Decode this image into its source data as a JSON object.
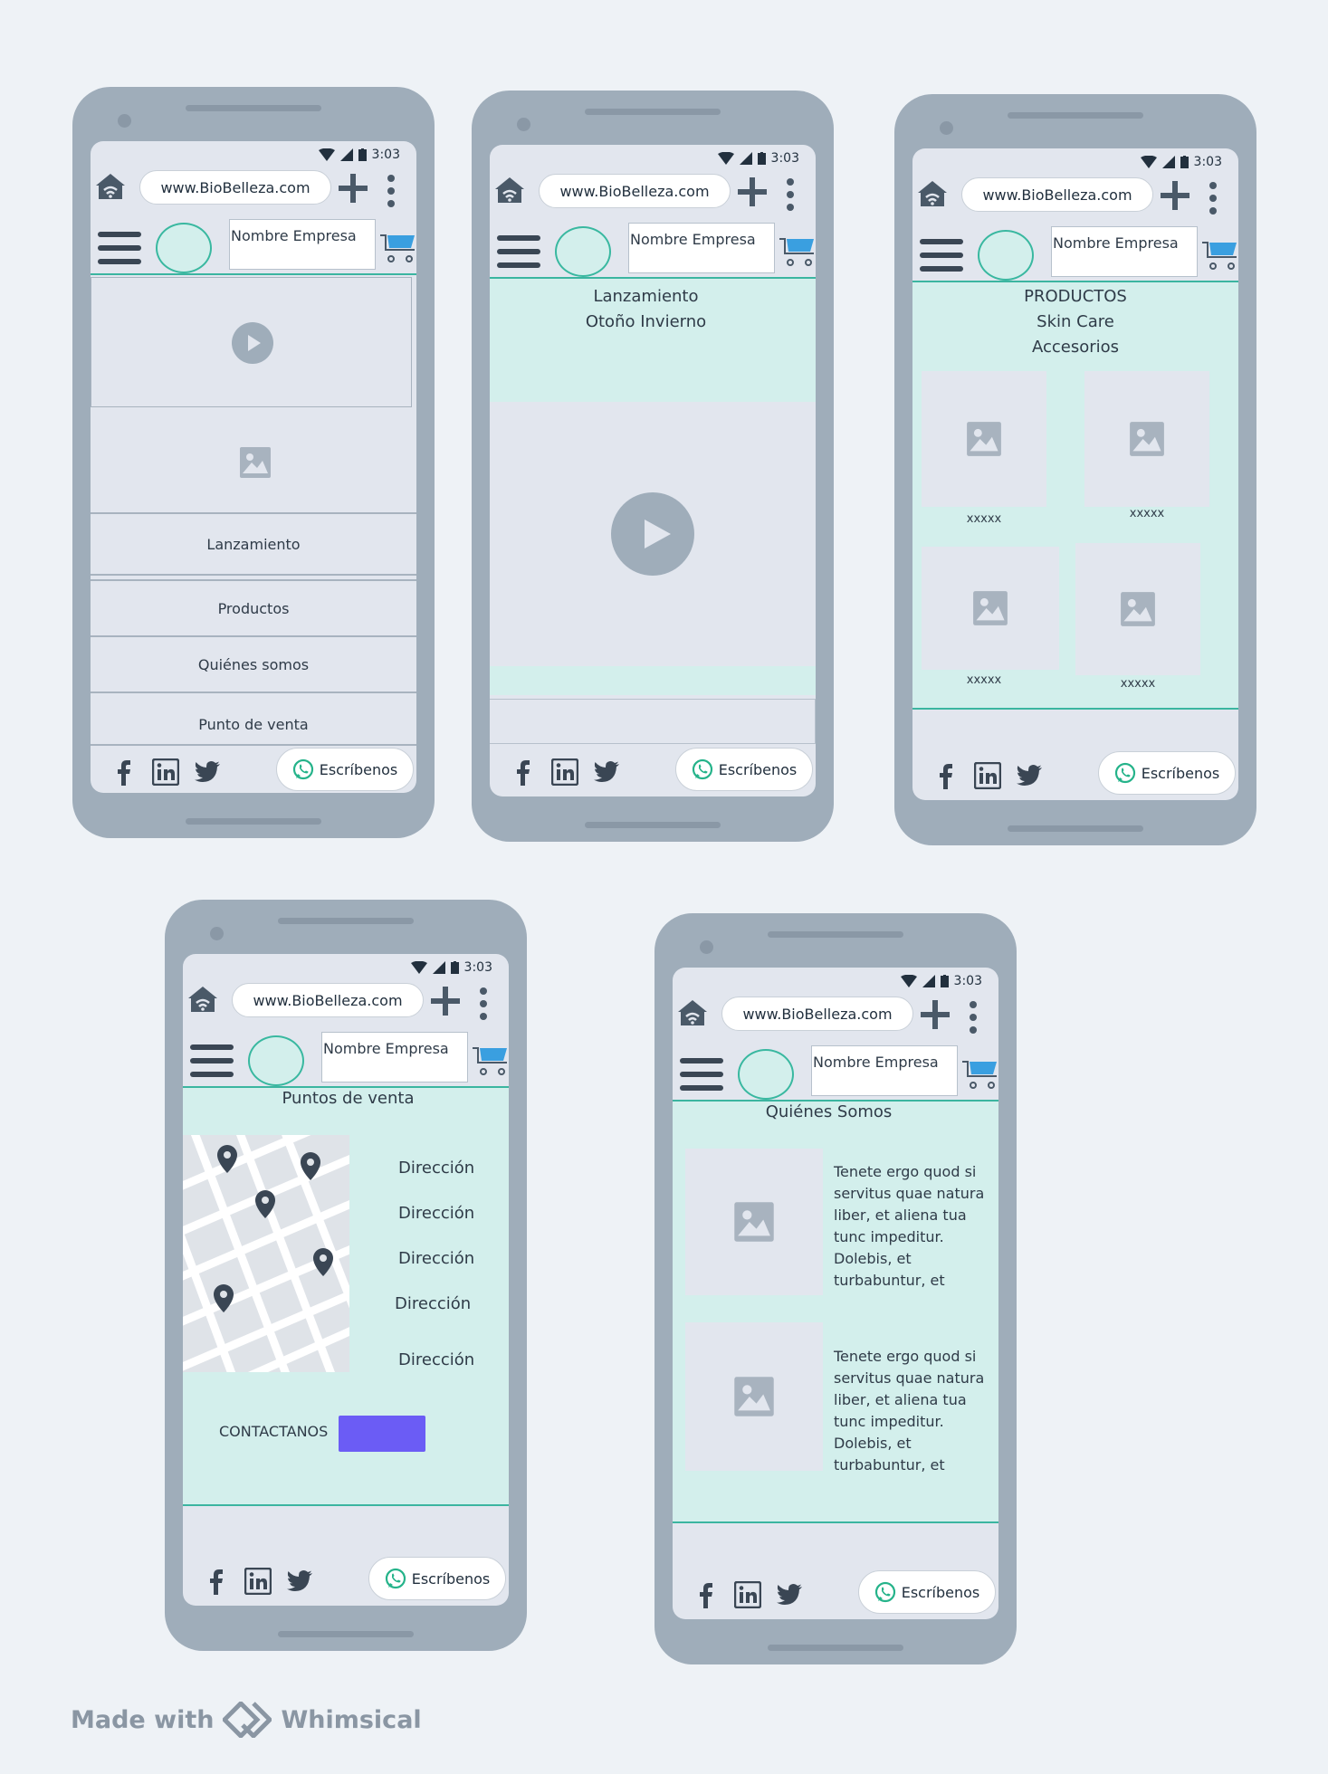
{
  "common": {
    "time": "3:03",
    "url": "www.BioBelleza.com",
    "company": "Nombre Empresa",
    "whatsapp": "Escríbenos"
  },
  "screen1": {
    "menu": [
      "Lanzamiento",
      "Productos",
      "Quiénes somos",
      "Punto de venta"
    ]
  },
  "screen2": {
    "title_line1": "Lanzamiento",
    "title_line2": "Otoño Invierno"
  },
  "screen3": {
    "title1": "PRODUCTOS",
    "title2": "Skin Care",
    "title3": "Accesorios",
    "items": [
      "xxxxx",
      "xxxxx",
      "xxxxx",
      "xxxxx"
    ]
  },
  "screen4": {
    "title": "Puntos de venta",
    "addresses": [
      "Dirección",
      "Dirección",
      "Dirección",
      "Dirección",
      "Dirección"
    ],
    "contact": "CONTACTANOS",
    "contact_button_color": "#6b5cf5"
  },
  "screen5": {
    "title": "Quiénes Somos",
    "para1": "Tenete ergo quod si servitus quae natura liber, et aliena tua tunc impeditur. Dolebis, et turbabuntur, et",
    "para2": "Tenete ergo quod si servitus quae natura liber, et aliena tua tunc impeditur. Dolebis, et turbabuntur, et"
  },
  "branding": {
    "made_with": "Made with",
    "brand": "Whimsical"
  },
  "colors": {
    "teal_bg": "#d3efec",
    "teal_line": "#3bb5a0",
    "phone_frame": "#9fadba",
    "screen_bg": "#e2e6ee",
    "cart_blue": "#3a9fe0",
    "whatsapp_green": "#25b38a"
  }
}
